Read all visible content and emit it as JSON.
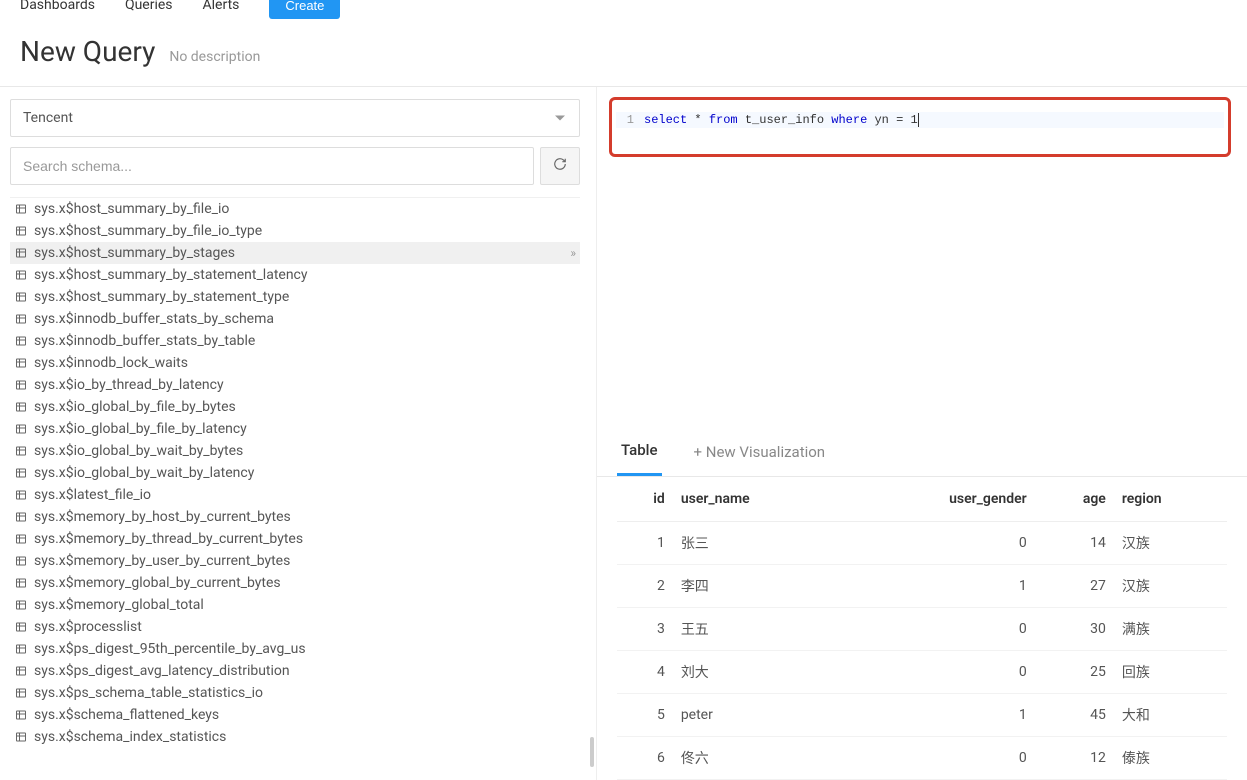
{
  "nav": {
    "dashboards": "Dashboards",
    "queries": "Queries",
    "alerts": "Alerts",
    "create": "Create"
  },
  "header": {
    "title": "New Query",
    "subtitle": "No description"
  },
  "datasource": {
    "selected": "Tencent"
  },
  "search": {
    "placeholder": "Search schema..."
  },
  "schema": {
    "items": [
      "sys.x$host_summary_by_file_io",
      "sys.x$host_summary_by_file_io_type",
      "sys.x$host_summary_by_stages",
      "sys.x$host_summary_by_statement_latency",
      "sys.x$host_summary_by_statement_type",
      "sys.x$innodb_buffer_stats_by_schema",
      "sys.x$innodb_buffer_stats_by_table",
      "sys.x$innodb_lock_waits",
      "sys.x$io_by_thread_by_latency",
      "sys.x$io_global_by_file_by_bytes",
      "sys.x$io_global_by_file_by_latency",
      "sys.x$io_global_by_wait_by_bytes",
      "sys.x$io_global_by_wait_by_latency",
      "sys.x$latest_file_io",
      "sys.x$memory_by_host_by_current_bytes",
      "sys.x$memory_by_thread_by_current_bytes",
      "sys.x$memory_by_user_by_current_bytes",
      "sys.x$memory_global_by_current_bytes",
      "sys.x$memory_global_total",
      "sys.x$processlist",
      "sys.x$ps_digest_95th_percentile_by_avg_us",
      "sys.x$ps_digest_avg_latency_distribution",
      "sys.x$ps_schema_table_statistics_io",
      "sys.x$schema_flattened_keys",
      "sys.x$schema_index_statistics"
    ],
    "hovered_index": 2
  },
  "editor": {
    "line_no": "1",
    "tokens": {
      "select": "select",
      "star": "*",
      "from": "from",
      "table": "t_user_info",
      "where": "where",
      "cond_field": "yn",
      "eq": "=",
      "cond_val": "1"
    }
  },
  "tabs": {
    "table": "Table",
    "new_vis": "+ New Visualization"
  },
  "results": {
    "columns": [
      "id",
      "user_name",
      "user_gender",
      "age",
      "region"
    ],
    "rows": [
      {
        "id": "1",
        "user_name": "张三",
        "user_gender": "0",
        "age": "14",
        "region": "汉族"
      },
      {
        "id": "2",
        "user_name": "李四",
        "user_gender": "1",
        "age": "27",
        "region": "汉族"
      },
      {
        "id": "3",
        "user_name": "王五",
        "user_gender": "0",
        "age": "30",
        "region": "满族"
      },
      {
        "id": "4",
        "user_name": "刘大",
        "user_gender": "0",
        "age": "25",
        "region": "回族"
      },
      {
        "id": "5",
        "user_name": "peter",
        "user_gender": "1",
        "age": "45",
        "region": "大和"
      },
      {
        "id": "6",
        "user_name": "佟六",
        "user_gender": "0",
        "age": "12",
        "region": "傣族"
      }
    ]
  }
}
